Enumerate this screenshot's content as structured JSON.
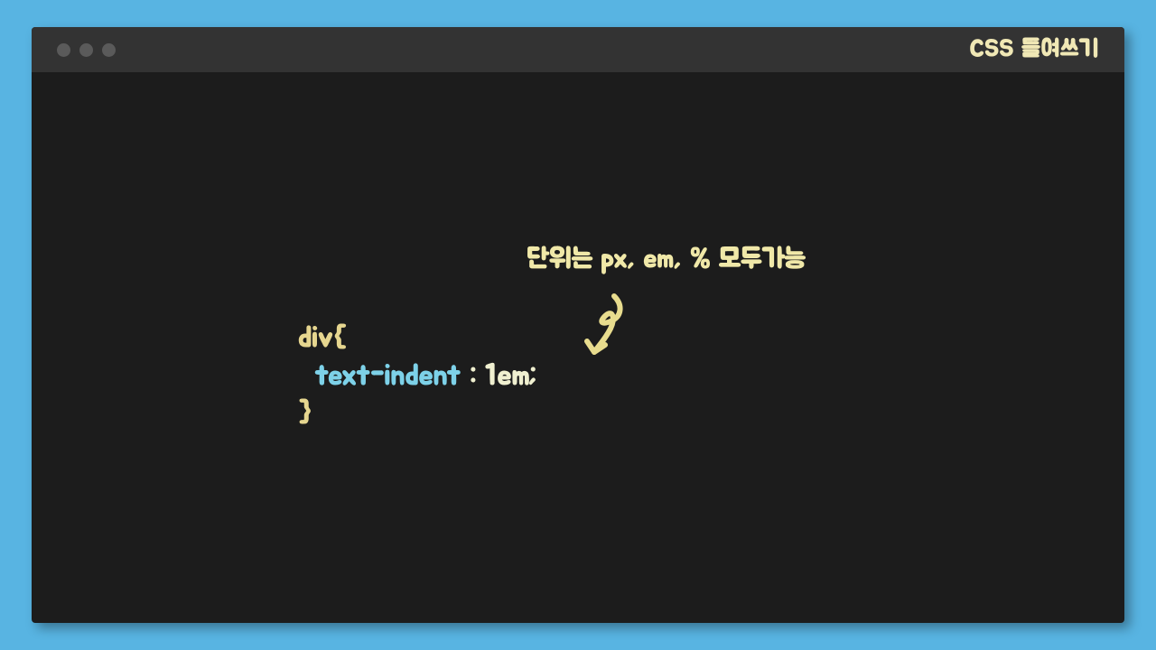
{
  "window": {
    "title": "CSS 들여쓰기"
  },
  "annotation": {
    "text": "단위는 px, em, % 모두가능"
  },
  "code": {
    "selector": "div",
    "brace_open": "{",
    "property": "text-indent",
    "colon": " :",
    "value": " 1em",
    "semicolon": ";",
    "brace_close": "}"
  }
}
